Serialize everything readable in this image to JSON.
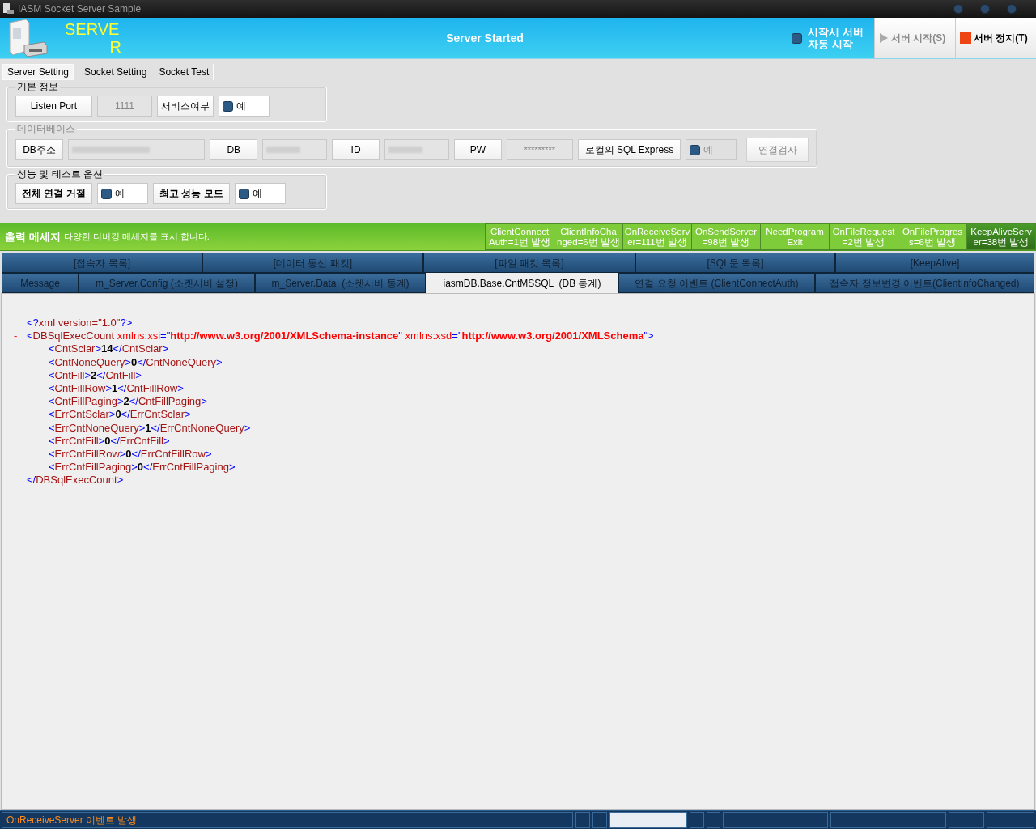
{
  "window": {
    "title": "IASM Socket Server Sample"
  },
  "header": {
    "logo_lines": [
      "SERVE",
      "R"
    ],
    "status": "Server Started",
    "autostart": {
      "label_lines": [
        "시작시 서버",
        "자동 시작"
      ],
      "checked": false
    },
    "buttons": [
      {
        "label": "서버 시작(S)",
        "kind": "start",
        "disabled": true
      },
      {
        "label": "서버 정지(T)",
        "kind": "stop",
        "disabled": false
      }
    ]
  },
  "tabs": [
    {
      "label": "Server Setting",
      "selected": true
    },
    {
      "label": "Socket Setting",
      "selected": false
    },
    {
      "label": "Socket Test",
      "selected": false
    }
  ],
  "basic": {
    "title": "기본 정보",
    "port_label": "Listen Port",
    "port_value": "1111",
    "service_label": "서비스여부",
    "service": {
      "label": "예",
      "checked": false
    }
  },
  "database": {
    "title": "데이터베이스",
    "disabled": true,
    "address_label": "DB주소",
    "db_label": "DB",
    "id_label": "ID",
    "pw_label": "PW",
    "pw_value": "*********",
    "local_label": "로컬의 SQL Express",
    "local": {
      "label": "예",
      "checked": false,
      "disabled": true
    },
    "test_button": {
      "label": "연결검사",
      "disabled": true
    }
  },
  "options": {
    "title": "성능 및 테스트 옵션",
    "items": [
      {
        "label": "전체 연결 거절",
        "check_label": "예",
        "checked": false
      },
      {
        "label": "최고 성능 모드",
        "check_label": "예",
        "checked": false
      }
    ]
  },
  "output": {
    "title": "출력 메세지",
    "subtitle": "다양한 디버깅 메세지를 표시 합니다.",
    "events": [
      [
        "ClientConnect",
        "Auth=1번 발생"
      ],
      [
        "ClientInfoCha",
        "nged=6번 발생"
      ],
      [
        "OnReceiveServ",
        "er=111번 발생"
      ],
      [
        "OnSendServer",
        "=98번 발생"
      ],
      [
        "NeedProgram",
        "Exit"
      ],
      [
        "OnFileRequest",
        "=2번 발생"
      ],
      [
        "OnFileProgres",
        "s=6번 발생"
      ],
      [
        "KeepAliveServ",
        "er=38번 발생"
      ]
    ]
  },
  "output_tabs": [
    [
      {
        "label": "[접속자 목록]",
        "selected": false
      },
      {
        "label": "[데이터 통신 패킷]",
        "selected": false
      },
      {
        "label": "[파일 패킷 목록]",
        "selected": false
      },
      {
        "label": "[SQL문 목록]",
        "selected": false
      },
      {
        "label": "[KeepAlive]",
        "selected": false
      }
    ],
    [
      {
        "label": "Message",
        "selected": false
      },
      {
        "label": "m_Server.Config (소켓서버 설정)",
        "selected": false
      },
      {
        "label": "m_Server.Data  (소켓서버 통계)",
        "selected": false
      },
      {
        "label": "iasmDB.Base.CntMSSQL  (DB 통계)",
        "selected": true
      },
      {
        "label": "연결 요청 이벤트 (ClientConnectAuth)",
        "selected": false
      },
      {
        "label": "접속자 정보변경 이벤트(ClientInfoChanged)",
        "selected": false
      }
    ]
  ],
  "xml": {
    "declaration": [
      {
        "kind": "p",
        "text": "<?"
      },
      {
        "kind": "n",
        "text": "xml version=\"1.0\""
      },
      {
        "kind": "p",
        "text": "?>"
      }
    ],
    "root": {
      "toggle": "-",
      "open": [
        {
          "kind": "p",
          "text": "<"
        },
        {
          "kind": "n",
          "text": "DBSqlExecCount"
        },
        {
          "kind": "an",
          "text": " xmlns:xsi"
        },
        {
          "kind": "p",
          "text": "=\""
        },
        {
          "kind": "av",
          "text": "http://www.w3.org/2001/XMLSchema-instance"
        },
        {
          "kind": "p",
          "text": "\""
        },
        {
          "kind": "an",
          "text": " xmlns:xsd"
        },
        {
          "kind": "p",
          "text": "=\""
        },
        {
          "kind": "av",
          "text": "http://www.w3.org/2001/XMLSchema"
        },
        {
          "kind": "p",
          "text": "\">"
        }
      ],
      "children": [
        {
          "name": "CntSclar",
          "value": "14",
          "end_name": "CntSclar",
          "lt": "<",
          "gt": ">",
          "lt_end": "</",
          "gt_end": ">"
        },
        {
          "name": "CntNoneQuery",
          "value": "0",
          "end_name": "CntNoneQuery",
          "lt": "<",
          "gt": ">",
          "lt_end": "</",
          "gt_end": ">"
        },
        {
          "name": "CntFill",
          "value": "2",
          "end_name": "CntFill",
          "lt": "<",
          "gt": ">",
          "lt_end": "</",
          "gt_end": ">"
        },
        {
          "name": "CntFillRow",
          "value": "1",
          "end_name": "CntFillRow",
          "lt": "<",
          "gt": ">",
          "lt_end": "</",
          "gt_end": ">"
        },
        {
          "name": "CntFillPaging",
          "value": "2",
          "end_name": "CntFillPaging",
          "lt": "<",
          "gt": ">",
          "lt_end": "</",
          "gt_end": ">"
        },
        {
          "name": "ErrCntSclar",
          "value": "0",
          "end_name": "ErrCntSclar",
          "lt": "<",
          "gt": ">",
          "lt_end": "</",
          "gt_end": ">"
        },
        {
          "name": "ErrCntNoneQuery",
          "value": "1",
          "end_name": "ErrCntNoneQuery",
          "lt": "<",
          "gt": ">",
          "lt_end": "</",
          "gt_end": ">"
        },
        {
          "name": "ErrCntFill",
          "value": "0",
          "end_name": "ErrCntFill",
          "lt": "<",
          "gt": ">",
          "lt_end": "</",
          "gt_end": ">"
        },
        {
          "name": "ErrCntFillRow",
          "value": "0",
          "end_name": "ErrCntFillRow",
          "lt": "<",
          "gt": ">",
          "lt_end": "</",
          "gt_end": ">"
        },
        {
          "name": "ErrCntFillPaging",
          "value": "0",
          "end_name": "ErrCntFillPaging",
          "lt": "<",
          "gt": ">",
          "lt_end": "</",
          "gt_end": ">"
        }
      ],
      "close": [
        {
          "kind": "p",
          "text": "</"
        },
        {
          "kind": "n",
          "text": "DBSqlExecCount"
        },
        {
          "kind": "p",
          "text": ">"
        }
      ]
    }
  },
  "status_bar": {
    "message": "OnReceiveServer 이벤트 발생"
  }
}
